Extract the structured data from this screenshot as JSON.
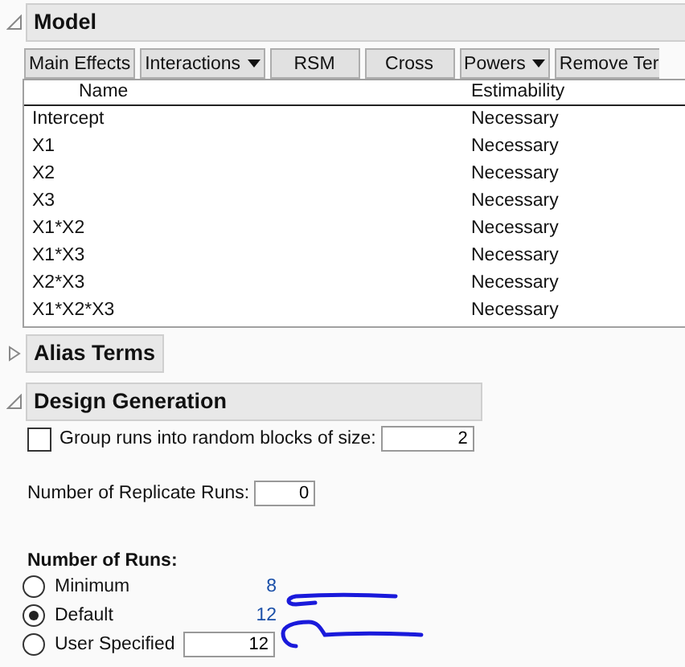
{
  "model": {
    "title": "Model",
    "expanded": true,
    "buttons": [
      {
        "label": "Main Effects",
        "dropdown": false
      },
      {
        "label": "Interactions",
        "dropdown": true
      },
      {
        "label": "RSM",
        "dropdown": false
      },
      {
        "label": "Cross",
        "dropdown": false
      },
      {
        "label": "Powers",
        "dropdown": true
      },
      {
        "label": "Remove Ter",
        "dropdown": false
      }
    ],
    "table": {
      "columns": [
        "Name",
        "Estimability"
      ],
      "rows": [
        [
          "Intercept",
          "Necessary"
        ],
        [
          "X1",
          "Necessary"
        ],
        [
          "X2",
          "Necessary"
        ],
        [
          "X3",
          "Necessary"
        ],
        [
          "X1*X2",
          "Necessary"
        ],
        [
          "X1*X3",
          "Necessary"
        ],
        [
          "X2*X3",
          "Necessary"
        ],
        [
          "X1*X2*X3",
          "Necessary"
        ]
      ]
    }
  },
  "alias_terms": {
    "title": "Alias Terms",
    "expanded": false
  },
  "design_generation": {
    "title": "Design Generation",
    "expanded": true,
    "group_runs": {
      "label": "Group runs into random blocks of size:",
      "checked": false,
      "value": "2"
    },
    "replicate_runs": {
      "label": "Number of Replicate Runs:",
      "value": "0"
    },
    "number_of_runs": {
      "title": "Number of Runs:",
      "options": [
        {
          "kind": "value",
          "label": "Minimum",
          "value": "8",
          "selected": false
        },
        {
          "kind": "value",
          "label": "Default",
          "value": "12",
          "selected": true
        },
        {
          "kind": "input",
          "label": "User Specified",
          "value": "12",
          "selected": false
        }
      ]
    }
  }
}
